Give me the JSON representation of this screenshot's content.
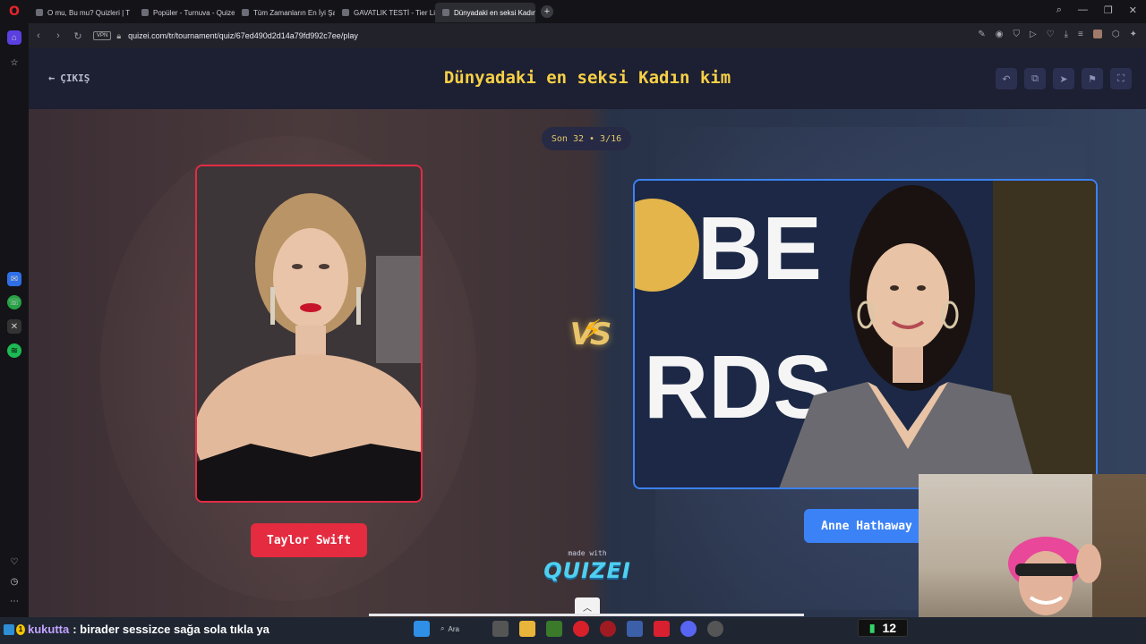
{
  "browser": {
    "tabs": [
      {
        "label": "O mu, Bu mu? Quizleri | T"
      },
      {
        "label": "Popüler - Turnuva - Quizei"
      },
      {
        "label": "Tüm Zamanların En İyi Şar"
      },
      {
        "label": "GAVATLIK TESTİ - Tier List"
      },
      {
        "label": "Dünyadaki en seksi Kadın"
      }
    ],
    "vpn_label": "VPN",
    "url": "quizei.com/tr/tournament/quiz/67ed490d2d14a79fd992c7ee/play"
  },
  "header": {
    "exit_label": "ÇIKIŞ",
    "title": "Dünyadaki en seksi Kadın kim"
  },
  "round": {
    "label": "Son 32 • 3/16"
  },
  "contestants": {
    "left": {
      "name": "Taylor Swift",
      "color": "#e42b3f"
    },
    "right": {
      "name": "Anne Hathaway",
      "color": "#3b82f6"
    }
  },
  "vs_label": "VS",
  "footer": {
    "made_with": "made with",
    "brand": "QUIZEI"
  },
  "backdrop_text": {
    "line1": "BE",
    "line2": "RDS"
  },
  "chat": {
    "user": "kukutta",
    "message": ": birader sessizce sağa sola tıkla ya"
  },
  "taskbar": {
    "search_label": "Ara",
    "counter_value": "12"
  }
}
